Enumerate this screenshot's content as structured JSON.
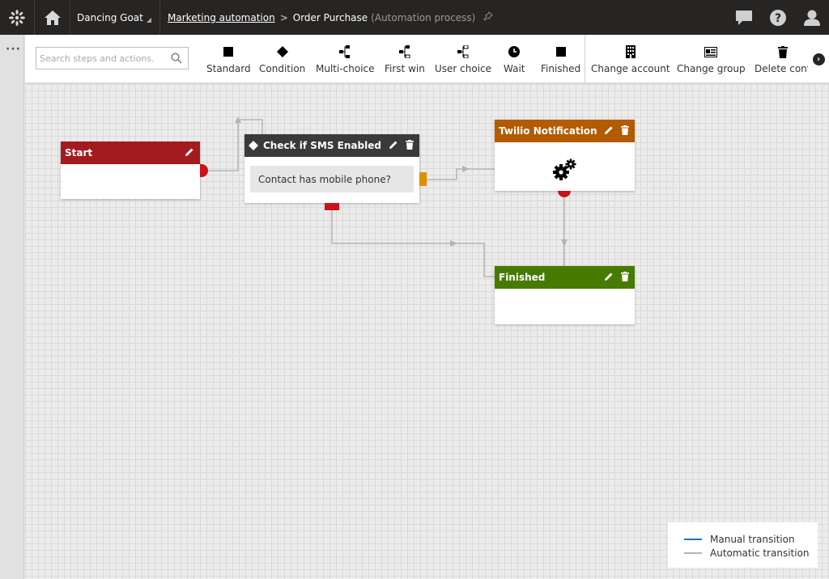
{
  "header": {
    "site": "Dancing Goat",
    "breadcrumb_link": "Marketing automation",
    "breadcrumb_current": "Order Purchase",
    "breadcrumb_type": "(Automation process)"
  },
  "toolbar": {
    "search_placeholder": "Search steps and actions.",
    "tools": [
      {
        "label": "Standard",
        "icon": "square-icon"
      },
      {
        "label": "Condition",
        "icon": "diamond-icon"
      },
      {
        "label": "Multi-choice",
        "icon": "multi-choice-icon"
      },
      {
        "label": "First win",
        "icon": "first-win-icon"
      },
      {
        "label": "User choice",
        "icon": "user-choice-icon"
      },
      {
        "label": "Wait",
        "icon": "clock-icon"
      },
      {
        "label": "Finished",
        "icon": "square-icon"
      },
      {
        "label": "Change account",
        "icon": "building-icon"
      },
      {
        "label": "Change group",
        "icon": "group-card-icon"
      },
      {
        "label": "Delete cont",
        "icon": "trash-icon"
      }
    ]
  },
  "workflow": {
    "start": {
      "title": "Start",
      "color": "#a31b1e"
    },
    "condition": {
      "title": "Check if SMS Enabled",
      "body": "Contact has mobile phone?",
      "color": "#3b3a39"
    },
    "twilio": {
      "title": "Twilio Notification",
      "color": "#b35b00"
    },
    "finished": {
      "title": "Finished",
      "color": "#477b00"
    }
  },
  "legend": {
    "manual": {
      "label": "Manual transition",
      "color": "#1f73c2"
    },
    "automatic": {
      "label": "Automatic transition",
      "color": "#b4b4b4"
    }
  }
}
